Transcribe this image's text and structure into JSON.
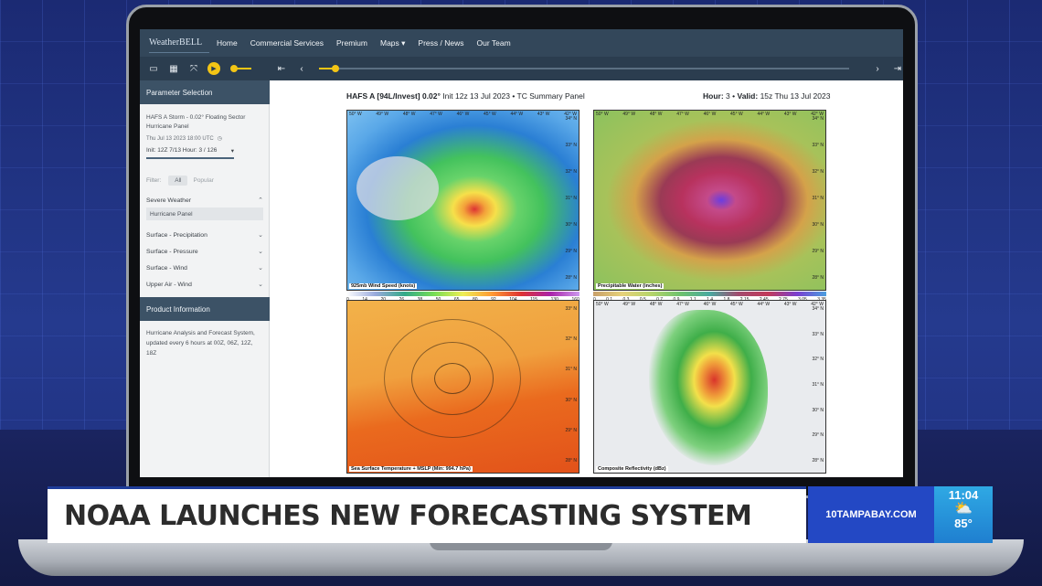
{
  "nav": {
    "logo": "WeatherBELL",
    "items": [
      "Home",
      "Commercial Services",
      "Premium",
      "Maps ▾",
      "Press / News",
      "Our Team"
    ]
  },
  "toolbar": {
    "icons": [
      "single-panel-icon",
      "grid-panel-icon",
      "swap-icon",
      "play-icon",
      "speed-slider",
      "first-frame-icon",
      "prev-frame-icon",
      "next-frame-icon",
      "last-frame-icon"
    ]
  },
  "sidebar": {
    "param_header": "Parameter Selection",
    "product_line1": "HAFS A Storm - 0.02° Floating Sector",
    "product_line2": "Hurricane Panel",
    "datetime": "Thu Jul 13 2023 18:00 UTC",
    "init_label": "Init: 12Z 7/13  Hour: 3 / 126",
    "filter_label": "Filter:",
    "filter_all": "All",
    "filter_popular": "Popular",
    "categories": [
      {
        "label": "Severe Weather",
        "chevron": "⌃"
      },
      {
        "label": "Surface - Precipitation",
        "chevron": "⌄"
      },
      {
        "label": "Surface - Pressure",
        "chevron": "⌄"
      },
      {
        "label": "Surface - Wind",
        "chevron": "⌄"
      },
      {
        "label": "Upper Air - Wind",
        "chevron": "⌄"
      }
    ],
    "selected_sub": "Hurricane Panel",
    "product_header": "Product Information",
    "product_info": "Hurricane Analysis and Forecast System, updated every 6 hours at 00Z, 06Z, 12Z, 18Z"
  },
  "panel": {
    "title_bold": "HAFS A [94L/Invest] 0.02°",
    "title_rest": " Init 12z 13 Jul 2023 • TC Summary Panel",
    "hour_label": "Hour:",
    "hour_value": "3",
    "valid_label": "Valid:",
    "valid_value": "15z Thu 13 Jul 2023"
  },
  "maps": [
    {
      "label": "925mb Wind Speed (knots)",
      "colorbar_ticks": [
        "0",
        "14",
        "20",
        "26",
        "38",
        "50",
        "65",
        "80",
        "92",
        "104",
        "115",
        "130",
        "160"
      ]
    },
    {
      "label": "Precipitable Water (inches)",
      "colorbar_ticks": [
        "0",
        "0.1",
        "0.3",
        "0.5",
        "0.7",
        "0.9",
        "1.1",
        "1.4",
        "1.8",
        "2.15",
        "2.45",
        "2.75",
        "3.05",
        "3.35"
      ]
    },
    {
      "label": "Sea Surface Temperature + MSLP (Min: 994.7 hPa)",
      "colorbar_ticks": []
    },
    {
      "label": "Composite Reflectivity (dBz)",
      "colorbar_ticks": []
    }
  ],
  "map_axes": {
    "lon_top": [
      "50° W",
      "49° W",
      "48° W",
      "47° W",
      "46° W",
      "45° W",
      "44° W",
      "43° W",
      "42° W"
    ],
    "lat_right": [
      "34° N",
      "33° N",
      "32° N",
      "31° N",
      "30° N",
      "29° N",
      "28° N"
    ]
  },
  "lower_third": {
    "headline": "NOAA LAUNCHES NEW FORECASTING SYSTEM",
    "brand": "10TAMPABAY.COM",
    "time": "11:04",
    "temp": "85°",
    "weather_icon": "partly-cloudy-icon"
  },
  "colors": {
    "nav_bg": "#33475a",
    "accent_yellow": "#f3c515",
    "brand_blue": "#2348c4",
    "sky_blue": "#2fa9e4"
  }
}
